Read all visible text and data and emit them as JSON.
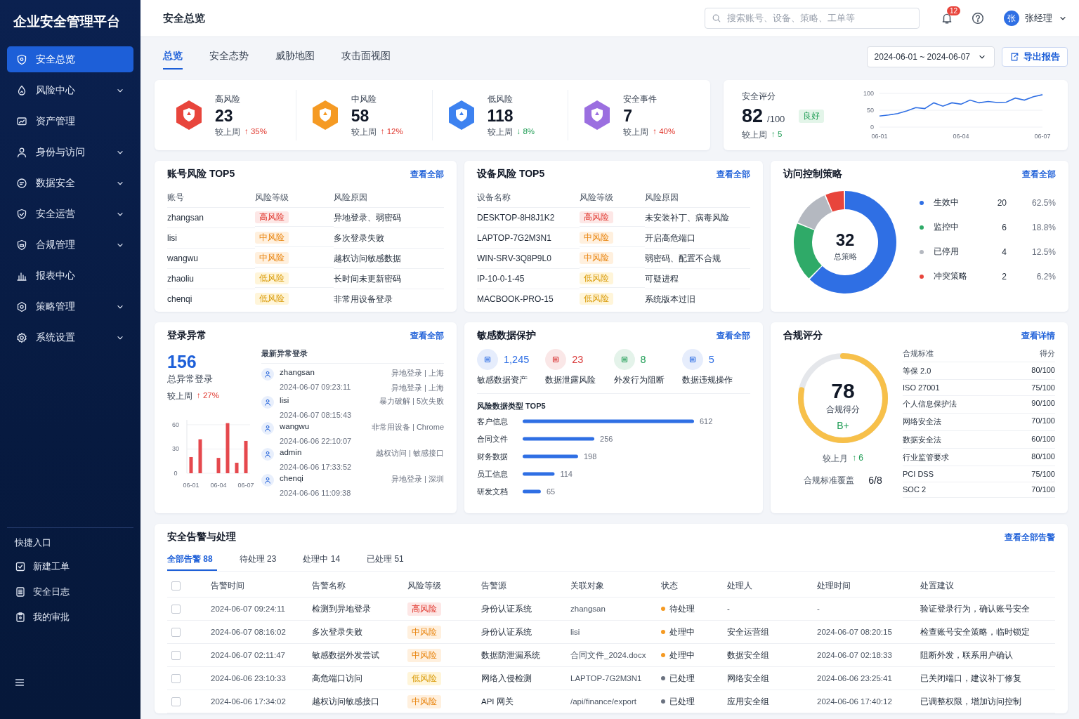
{
  "sidebar": {
    "title": "企业安全管理平台",
    "nav": [
      {
        "label": "安全总览",
        "selected": true,
        "expandable": false
      },
      {
        "label": "风险中心",
        "selected": false,
        "expandable": true
      },
      {
        "label": "资产管理",
        "selected": false,
        "expandable": false
      },
      {
        "label": "身份与访问",
        "selected": false,
        "expandable": true
      },
      {
        "label": "数据安全",
        "selected": false,
        "expandable": true
      },
      {
        "label": "安全运营",
        "selected": false,
        "expandable": true
      },
      {
        "label": "合规管理",
        "selected": false,
        "expandable": true
      },
      {
        "label": "报表中心",
        "selected": false,
        "expandable": false
      },
      {
        "label": "策略管理",
        "selected": false,
        "expandable": true
      },
      {
        "label": "系统设置",
        "selected": false,
        "expandable": true
      }
    ],
    "quick_title": "快捷入口",
    "quick": [
      "新建工单",
      "安全日志",
      "我的审批"
    ]
  },
  "header": {
    "title": "安全总览",
    "search": {
      "placeholder": "搜索账号、设备、策略、工单等"
    },
    "notifications": "12",
    "user": {
      "avatar": "张",
      "name": "张经理"
    }
  },
  "tabs": [
    {
      "label": "总览",
      "selected": true
    },
    {
      "label": "安全态势",
      "selected": false
    },
    {
      "label": "威胁地图",
      "selected": false
    },
    {
      "label": "攻击面视图",
      "selected": false
    }
  ],
  "date_range": "2024-06-01 ~ 2024-06-07",
  "export": "导出报告",
  "stats": [
    {
      "label": "高风险",
      "value": "23",
      "compare": "较上周",
      "delta": "↑ 35%",
      "alarming": true,
      "color": "#e8453c"
    },
    {
      "label": "中风险",
      "value": "58",
      "compare": "较上周",
      "delta": "↑ 12%",
      "alarming": true,
      "color": "#f59a23"
    },
    {
      "label": "低风险",
      "value": "118",
      "compare": "较上周",
      "delta": "↓ 8%",
      "alarming": false,
      "color": "#3d82f0"
    },
    {
      "label": "安全事件",
      "value": "7",
      "compare": "较上周",
      "delta": "↑ 40%",
      "alarming": true,
      "color": "#9b6fe0"
    }
  ],
  "score": {
    "label": "安全评分",
    "value": "82",
    "max": "/100",
    "badge": "良好",
    "compare": "较上周",
    "delta": "↑ 5",
    "alarming": false,
    "chart_data": {
      "type": "line",
      "categories": [
        "06-01",
        null,
        null,
        null,
        null,
        null,
        null,
        null,
        null,
        "06-04",
        null,
        null,
        null,
        null,
        null,
        null,
        null,
        null,
        "06-07"
      ],
      "series": [
        {
          "color": "#2f6fe4",
          "values": [
            33,
            36,
            40,
            48,
            58,
            55,
            72,
            62,
            72,
            68,
            80,
            72,
            76,
            73,
            74,
            86,
            80,
            90,
            96
          ]
        }
      ],
      "yticks": [
        0,
        50,
        100
      ],
      "ylim": [
        0,
        100
      ]
    }
  },
  "account_risk": {
    "title": "账号风险 TOP5",
    "link": "查看全部",
    "columns": [
      "账号",
      "风险等级",
      "风险原因"
    ],
    "rows": [
      {
        "name": "zhangsan",
        "risk": "高风险",
        "kind": "high",
        "reason": "异地登录、弱密码"
      },
      {
        "name": "lisi",
        "risk": "中风险",
        "kind": "medium",
        "reason": "多次登录失败"
      },
      {
        "name": "wangwu",
        "risk": "中风险",
        "kind": "medium",
        "reason": "越权访问敏感数据"
      },
      {
        "name": "zhaoliu",
        "risk": "低风险",
        "kind": "low",
        "reason": "长时间未更新密码"
      },
      {
        "name": "chenqi",
        "risk": "低风险",
        "kind": "low",
        "reason": "非常用设备登录"
      }
    ]
  },
  "device_risk": {
    "title": "设备风险 TOP5",
    "link": "查看全部",
    "columns": [
      "设备名称",
      "风险等级",
      "风险原因"
    ],
    "rows": [
      {
        "name": "DESKTOP-8H8J1K2",
        "risk": "高风险",
        "kind": "high",
        "reason": "未安装补丁、病毒风险"
      },
      {
        "name": "LAPTOP-7G2M3N1",
        "risk": "中风险",
        "kind": "medium",
        "reason": "开启高危端口"
      },
      {
        "name": "WIN-SRV-3Q8P9L0",
        "risk": "中风险",
        "kind": "medium",
        "reason": "弱密码、配置不合规"
      },
      {
        "name": "IP-10-0-1-45",
        "risk": "低风险",
        "kind": "low",
        "reason": "可疑进程"
      },
      {
        "name": "MACBOOK-PRO-15",
        "risk": "低风险",
        "kind": "low",
        "reason": "系统版本过旧"
      }
    ]
  },
  "access_policy": {
    "title": "访问控制策略",
    "link": "查看全部",
    "total": "32",
    "total_label": "总策略",
    "legend": [
      {
        "name": "生效中",
        "count": "20",
        "percent": "62.5%",
        "color": "#2f6fe4"
      },
      {
        "name": "监控中",
        "count": "6",
        "percent": "18.8%",
        "color": "#2faa68"
      },
      {
        "name": "已停用",
        "count": "4",
        "percent": "12.5%",
        "color": "#b4b8c0"
      },
      {
        "name": "冲突策略",
        "count": "2",
        "percent": "6.2%",
        "color": "#e8453c"
      }
    ],
    "chart_data": {
      "type": "donut",
      "values": [
        62.5,
        18.8,
        12.5,
        6.2
      ]
    }
  },
  "login_anomaly": {
    "title": "登录异常",
    "link": "查看全部",
    "total": "156",
    "total_label": "总异常登录",
    "compare": "较上周",
    "delta": "↑ 27%",
    "alarming": true,
    "chart_data": {
      "type": "bar",
      "categories": [
        "06-01",
        null,
        null,
        "06-04",
        null,
        null,
        "06-07"
      ],
      "series": [
        {
          "color": "#e5484d",
          "values": [
            20,
            42,
            null,
            19,
            62,
            13,
            40
          ]
        }
      ],
      "yticks": [
        0,
        30,
        60
      ],
      "ylim": [
        0,
        66
      ]
    },
    "recent_title": "最新异常登录",
    "recent": [
      {
        "user": "zhangsan",
        "time": "2024-06-07 09:23:11",
        "tags": [
          "异地登录 | 上海",
          "异地登录 | 上海"
        ]
      },
      {
        "user": "lisi",
        "time": "2024-06-07 08:15:43",
        "tags": [
          "暴力破解 | 5次失败"
        ]
      },
      {
        "user": "wangwu",
        "time": "2024-06-06 22:10:07",
        "tags": [
          "非常用设备 | Chrome"
        ]
      },
      {
        "user": "admin",
        "time": "2024-06-06 17:33:52",
        "tags": [
          "越权访问 | 敏感接口"
        ]
      },
      {
        "user": "chenqi",
        "time": "2024-06-06 11:09:38",
        "tags": [
          "异地登录 | 深圳"
        ]
      }
    ]
  },
  "sensitive_data": {
    "title": "敏感数据保护",
    "link": "查看全部",
    "metrics": [
      {
        "value": "1,245",
        "label": "敏感数据资产",
        "color": "#2f6fe4"
      },
      {
        "value": "23",
        "label": "数据泄露风险",
        "color": "#d93a3a"
      },
      {
        "value": "8",
        "label": "外发行为阻断",
        "color": "#1f9d55"
      },
      {
        "value": "5",
        "label": "数据违规操作",
        "color": "#2f6fe4"
      }
    ],
    "top_title": "风险数据类型 TOP5",
    "chart_data": {
      "type": "bar",
      "orientation": "horizontal",
      "categories": [
        "客户信息",
        "合同文件",
        "财务数据",
        "员工信息",
        "研发文档"
      ],
      "series": [
        {
          "color": "#2f6fe4",
          "values": [
            612,
            256,
            198,
            114,
            65
          ]
        }
      ],
      "data_labels": true
    }
  },
  "compliance": {
    "title": "合规评分",
    "link": "查看详情",
    "score": "78",
    "score_label": "合规得分",
    "grade": "B+",
    "level": 0.78,
    "compare": "较上月",
    "delta": "↑ 6",
    "alarming": false,
    "coverage_label": "合规标准覆盖",
    "coverage": "6/8",
    "columns": [
      "合规标准",
      "得分"
    ],
    "rows": [
      {
        "name": "等保 2.0",
        "score": "80/100"
      },
      {
        "name": "ISO 27001",
        "score": "75/100"
      },
      {
        "name": "个人信息保护法",
        "score": "90/100"
      },
      {
        "name": "网络安全法",
        "score": "70/100"
      },
      {
        "name": "数据安全法",
        "score": "60/100"
      },
      {
        "name": "行业监管要求",
        "score": "80/100"
      },
      {
        "name": "PCI DSS",
        "score": "75/100"
      },
      {
        "name": "SOC 2",
        "score": "70/100"
      }
    ]
  },
  "alerts": {
    "title": "安全告警与处理",
    "link": "查看全部告警",
    "tabs": [
      {
        "label": "全部告警 88",
        "selected": true
      },
      {
        "label": "待处理 23",
        "selected": false
      },
      {
        "label": "处理中 14",
        "selected": false
      },
      {
        "label": "已处理 51",
        "selected": false
      }
    ],
    "all_checked": false,
    "columns": [
      "告警时间",
      "告警名称",
      "风险等级",
      "告警源",
      "关联对象",
      "状态",
      "处理人",
      "处理时间",
      "处置建议"
    ],
    "rows": [
      {
        "checked": false,
        "time": "2024-06-07 09:24:11",
        "name": "检测到异地登录",
        "risk": "高风险",
        "kind": "high",
        "source": "身份认证系统",
        "target": "zhangsan",
        "status": "待处理",
        "color": "#f59a23",
        "owner": "-",
        "handled": "-",
        "advice": "验证登录行为，确认账号安全"
      },
      {
        "checked": false,
        "time": "2024-06-07 08:16:02",
        "name": "多次登录失败",
        "risk": "中风险",
        "kind": "medium",
        "source": "身份认证系统",
        "target": "lisi",
        "status": "处理中",
        "color": "#f59a23",
        "owner": "安全运营组",
        "handled": "2024-06-07 08:20:15",
        "advice": "检查账号安全策略，临时锁定"
      },
      {
        "checked": false,
        "time": "2024-06-07 02:11:47",
        "name": "敏感数据外发尝试",
        "risk": "中风险",
        "kind": "medium",
        "source": "数据防泄漏系统",
        "target": "合同文件_2024.docx",
        "status": "处理中",
        "color": "#f59a23",
        "owner": "数据安全组",
        "handled": "2024-06-07 02:18:33",
        "advice": "阻断外发，联系用户确认"
      },
      {
        "checked": false,
        "time": "2024-06-06 23:10:33",
        "name": "高危端口访问",
        "risk": "低风险",
        "kind": "low",
        "source": "网络入侵检测",
        "target": "LAPTOP-7G2M3N1",
        "status": "已处理",
        "color": "#6b7280",
        "owner": "网络安全组",
        "handled": "2024-06-06 23:25:41",
        "advice": "已关闭端口，建议补丁修复"
      },
      {
        "checked": false,
        "time": "2024-06-06 17:34:02",
        "name": "越权访问敏感接口",
        "risk": "中风险",
        "kind": "medium",
        "source": "API 网关",
        "target": "/api/finance/export",
        "status": "已处理",
        "color": "#6b7280",
        "owner": "应用安全组",
        "handled": "2024-06-06 17:40:12",
        "advice": "已调整权限，增加访问控制"
      }
    ]
  }
}
